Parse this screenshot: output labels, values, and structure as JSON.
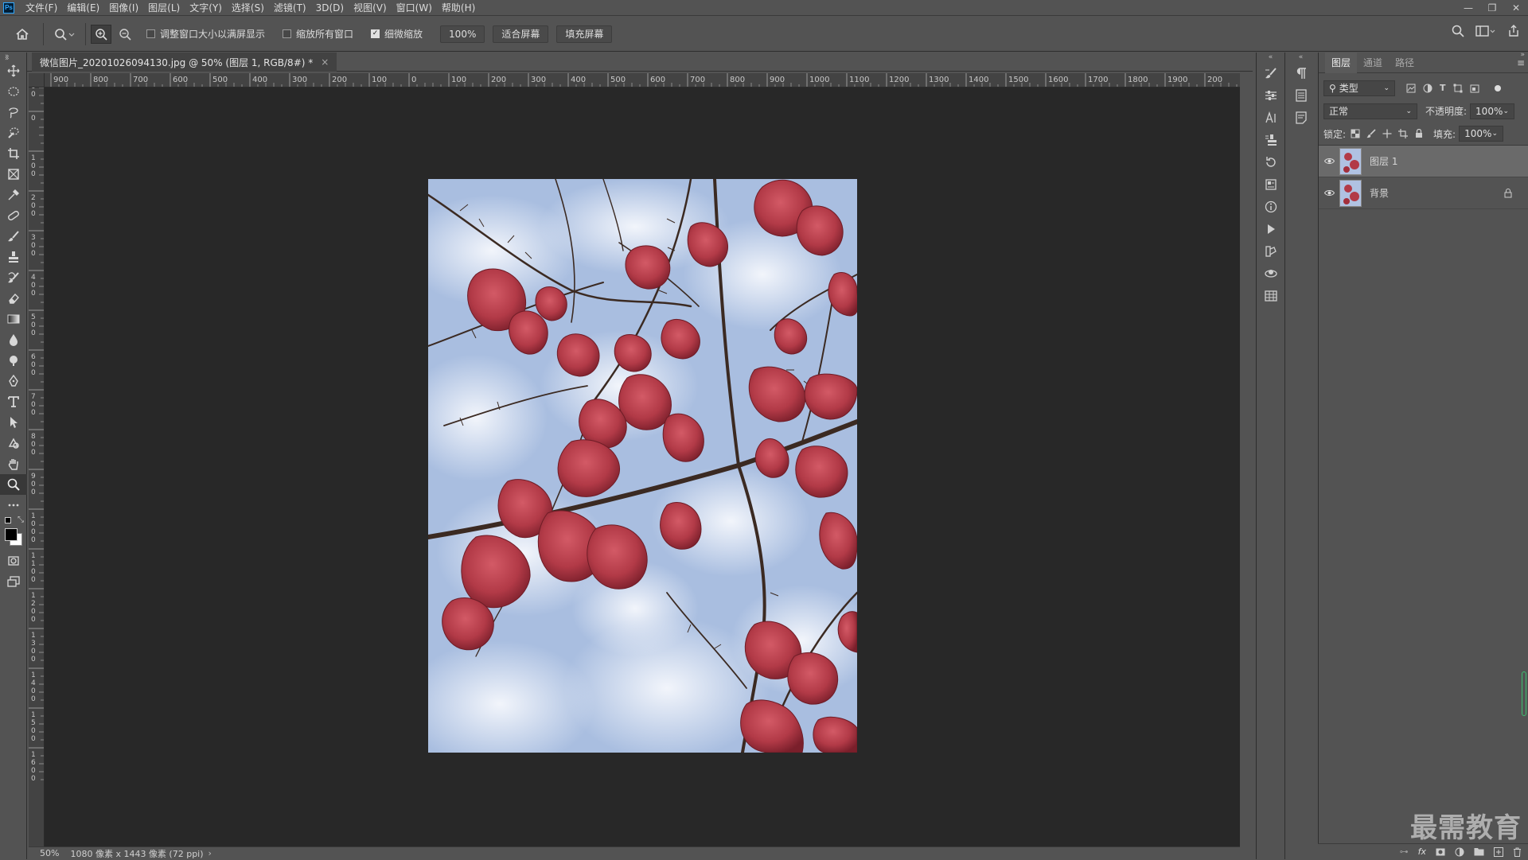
{
  "menubar": {
    "app_icon": "Ps",
    "items": [
      "文件(F)",
      "编辑(E)",
      "图像(I)",
      "图层(L)",
      "文字(Y)",
      "选择(S)",
      "滤镜(T)",
      "3D(D)",
      "视图(V)",
      "窗口(W)",
      "帮助(H)"
    ]
  },
  "options": {
    "check_resize": "调整窗口大小以满屏显示",
    "check_zoom_all": "缩放所有窗口",
    "check_scrubby": "细微缩放",
    "btn_100": "100%",
    "btn_fit": "适合屏幕",
    "btn_fill": "填充屏幕"
  },
  "document": {
    "tab_title": "微信图片_20201026094130.jpg @ 50% (图层 1, RGB/8#) *",
    "close": "×"
  },
  "ruler_top_labels": [
    "900",
    "800",
    "700",
    "600",
    "500",
    "400",
    "300",
    "200",
    "100",
    "0",
    "100",
    "200",
    "300",
    "400",
    "500",
    "600",
    "700",
    "800",
    "900",
    "1000",
    "1100",
    "1200",
    "1300",
    "1400",
    "1500",
    "1600",
    "1700",
    "1800",
    "1900",
    "200"
  ],
  "ruler_left_labels": [
    "100",
    "0",
    "100",
    "200",
    "300",
    "400",
    "500",
    "600",
    "700",
    "800",
    "900",
    "1000",
    "1100",
    "1200",
    "1300",
    "1400",
    "1500",
    "1600"
  ],
  "status": {
    "zoom": "50%",
    "info": "1080 像素 x 1443 像素 (72 ppi)"
  },
  "layers_panel": {
    "tabs": [
      "图层",
      "通道",
      "路径"
    ],
    "filter_kind": "类型",
    "blend_mode": "正常",
    "opacity_label": "不透明度:",
    "opacity_value": "100%",
    "lock_label": "锁定:",
    "fill_label": "填充:",
    "fill_value": "100%",
    "layers": [
      {
        "name": "图层 1",
        "active": true,
        "locked": false
      },
      {
        "name": "背景",
        "active": false,
        "locked": true
      }
    ]
  },
  "watermark": "最需教育",
  "colors": {
    "bg": "#535353",
    "canvas": "#282828",
    "accent": "#31a8ff"
  }
}
